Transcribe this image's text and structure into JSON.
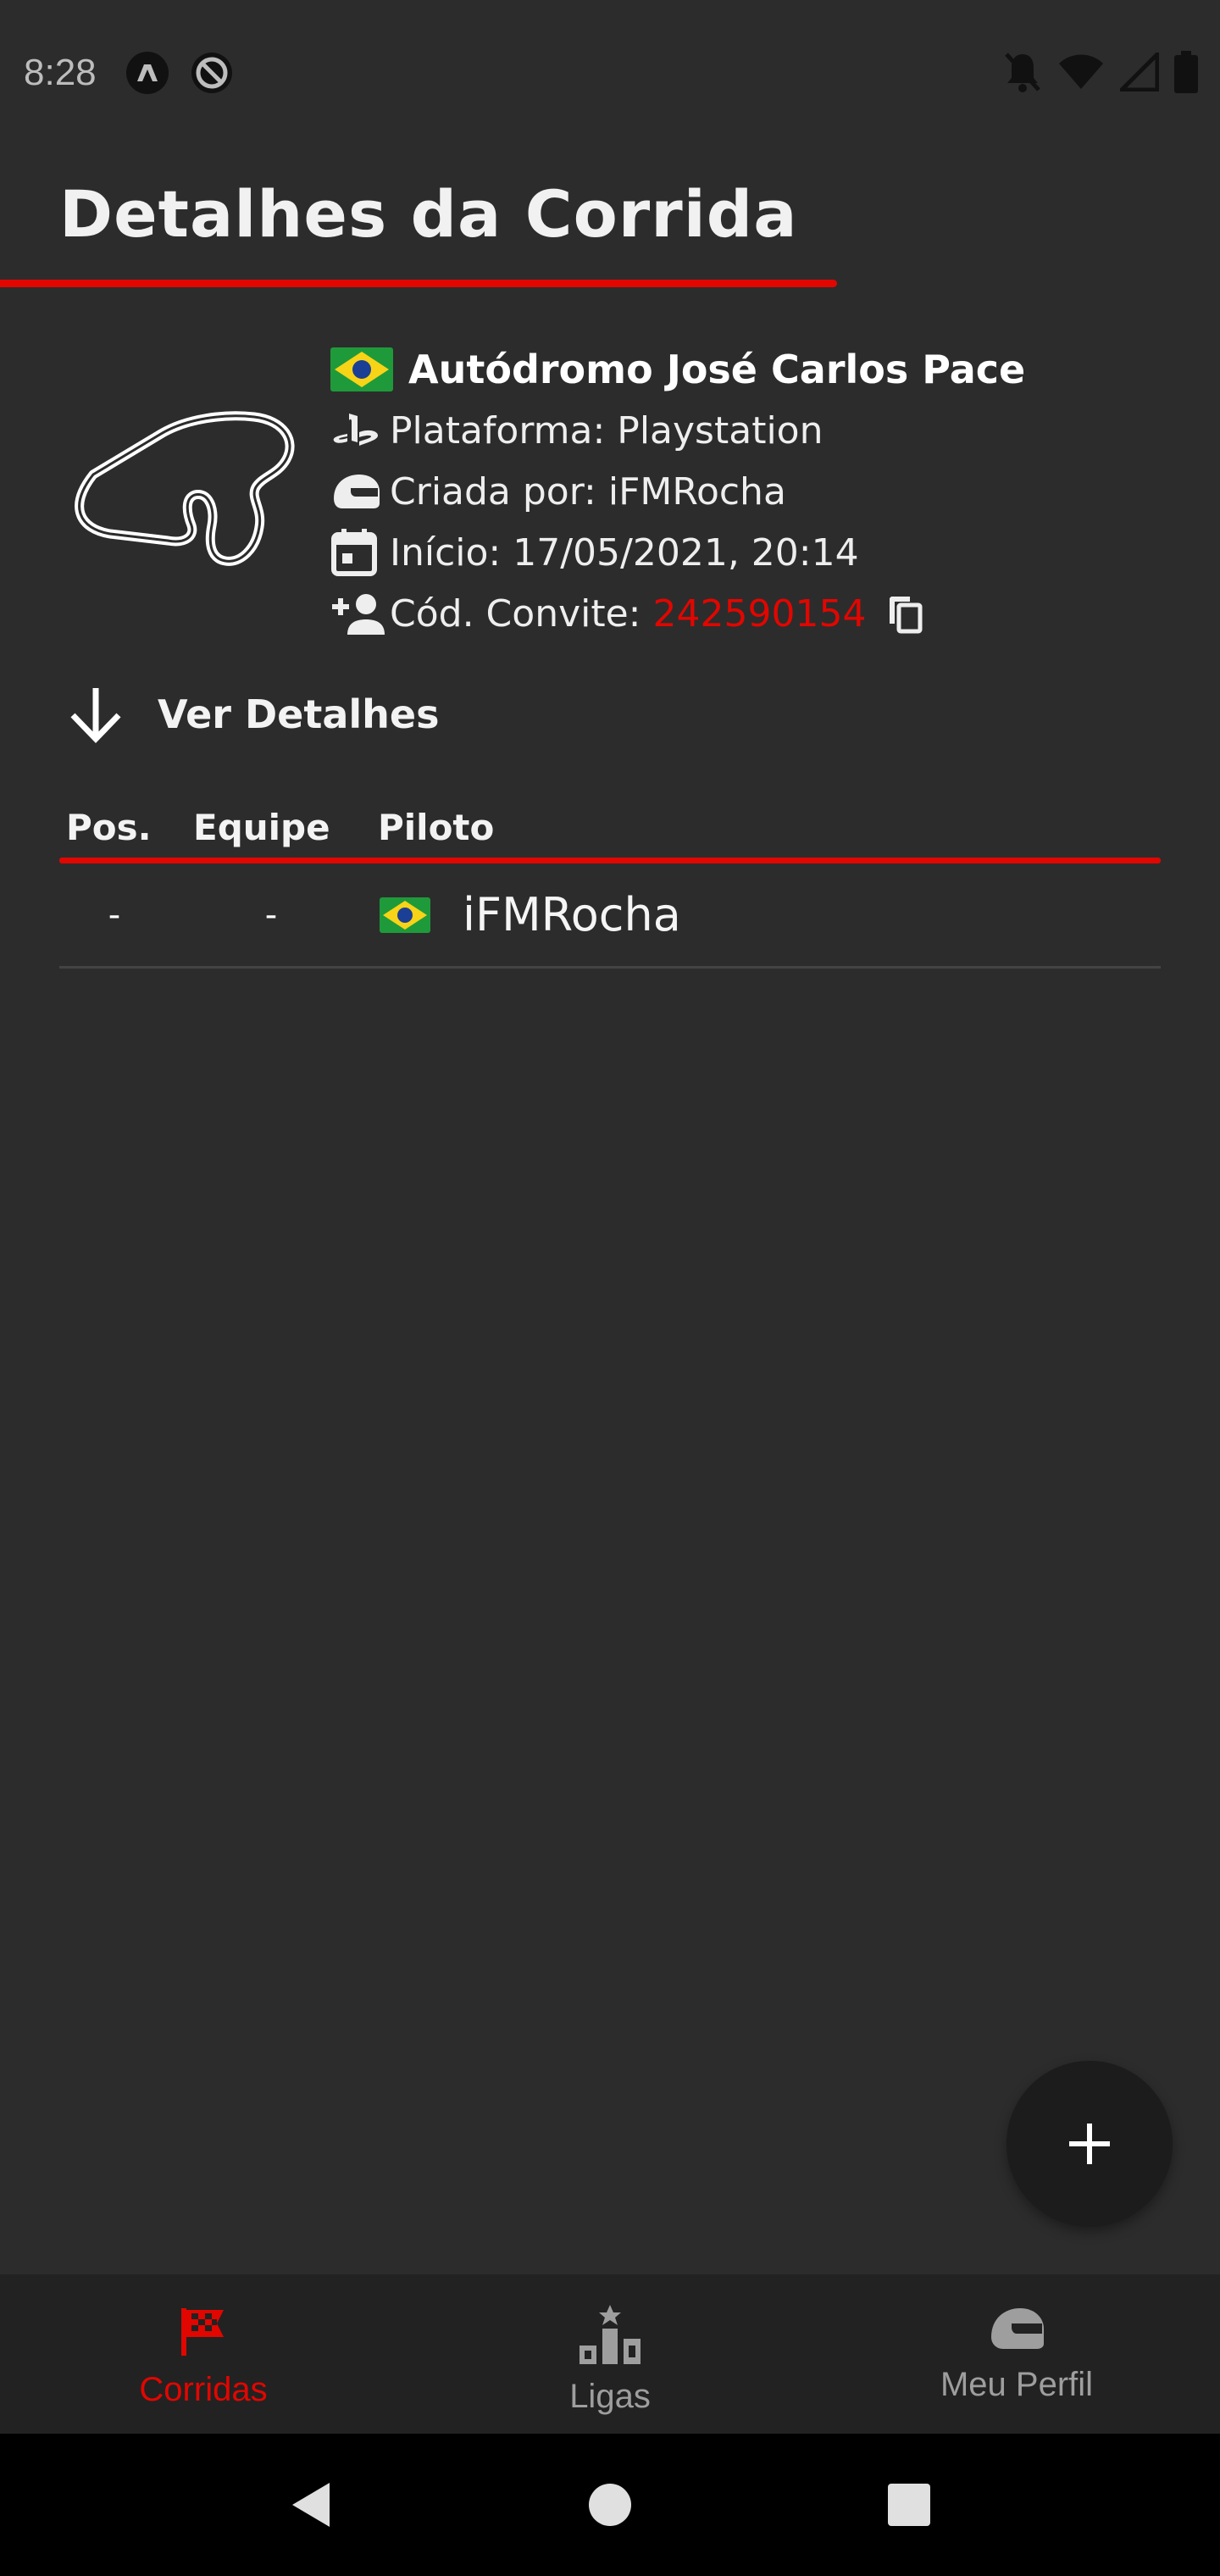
{
  "status_bar": {
    "time": "8:28",
    "icons": [
      "react-icon",
      "at-sign-icon",
      "notifications-off-icon",
      "wifi-icon",
      "signal-icon",
      "battery-icon"
    ]
  },
  "header": {
    "title": "Detalhes da Corrida"
  },
  "race": {
    "circuit_name": "Autódromo José Carlos Pace",
    "platform_label": "Plataforma: Playstation",
    "created_by_label": "Criada por: iFMRocha",
    "start_label": "Início: 17/05/2021, 20:14",
    "invite_label": "Cód. Convite:",
    "invite_code": "242590154"
  },
  "details_toggle": {
    "label": "Ver Detalhes"
  },
  "table": {
    "headers": {
      "pos": "Pos.",
      "team": "Equipe",
      "driver": "Piloto"
    },
    "rows": [
      {
        "pos": "-",
        "team": "-",
        "driver": "iFMRocha"
      }
    ]
  },
  "bottom_nav": {
    "items": [
      {
        "label": "Corridas",
        "icon": "checkered-flag-icon",
        "active": true
      },
      {
        "label": "Ligas",
        "icon": "podium-icon",
        "active": false
      },
      {
        "label": "Meu Perfil",
        "icon": "helmet-icon",
        "active": false
      }
    ]
  },
  "colors": {
    "accent": "#e10600",
    "background": "#2c2c2c",
    "nav_background": "#222222",
    "fab": "#1c1c1c"
  }
}
